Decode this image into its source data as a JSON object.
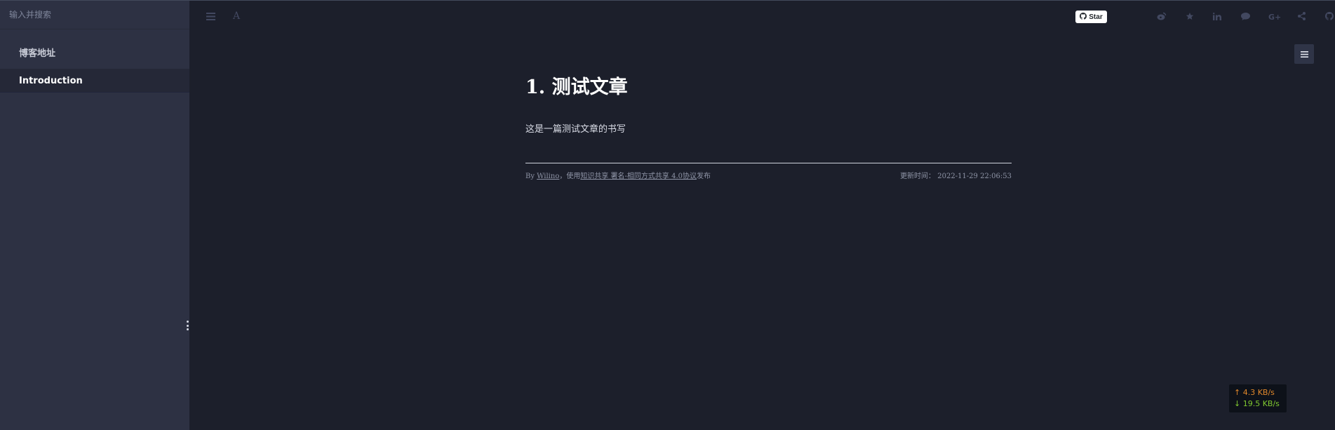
{
  "sidebar": {
    "search_placeholder": "输入并搜索",
    "items": [
      {
        "label": "博客地址"
      },
      {
        "label": "Introduction"
      }
    ]
  },
  "toolbar": {
    "left_icons": [
      "menu-icon",
      "font-settings-icon"
    ],
    "font_glyph": "A",
    "github_star_label": "Star",
    "right_icons": [
      "weibo-icon",
      "star-icon",
      "linkedin-icon",
      "comment-icon",
      "google-plus-icon",
      "share-icon",
      "github-icon"
    ]
  },
  "article": {
    "title": "1. 测试文章",
    "body": "这是一篇测试文章的书写",
    "footer": {
      "by": "By",
      "author": "Wilino",
      "license_prefix": "，使用",
      "license_link": "知识共享 署名-相同方式共享 4.0协议",
      "license_suffix": "发布",
      "updated_label": "更新时间：",
      "updated_time": "2022-11-29 22:06:53"
    }
  },
  "netspeed": {
    "upload": "↑ 4.3 KB/s",
    "download": "↓ 19.5 KB/s"
  },
  "colors": {
    "background": "#1c1f2b",
    "sidebar": "#2d3143",
    "upload": "#e0872b",
    "download": "#80c930"
  }
}
